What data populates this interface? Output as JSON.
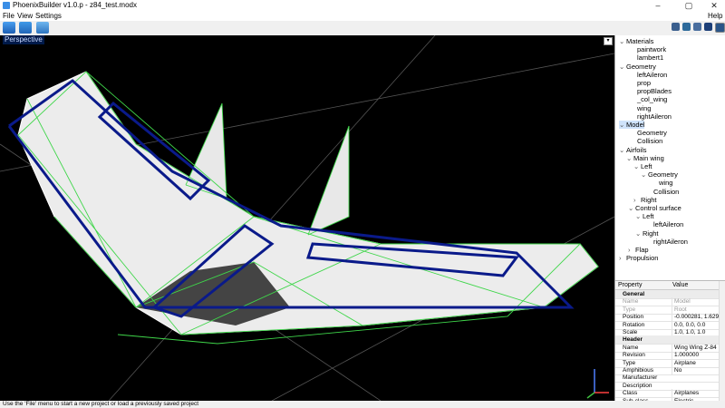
{
  "window": {
    "title": "PhoenixBuilder v1.0.p  - z84_test.modx",
    "controls": [
      "minimize-icon",
      "maximize-icon",
      "close-icon"
    ]
  },
  "menu": {
    "file": "File",
    "view": "View",
    "settings": "Settings",
    "help": "Help"
  },
  "viewport": {
    "label": "Perspective"
  },
  "tree": [
    {
      "label": "Materials",
      "toggle": "⌄"
    },
    {
      "label": "paintwork",
      "toggle": ""
    },
    {
      "label": "lambert1",
      "toggle": ""
    },
    {
      "label": "Geometry",
      "toggle": "⌄"
    },
    {
      "label": "leftAileron",
      "toggle": ""
    },
    {
      "label": "prop",
      "toggle": ""
    },
    {
      "label": "propBlades",
      "toggle": ""
    },
    {
      "label": "_col_wing",
      "toggle": ""
    },
    {
      "label": "wing",
      "toggle": ""
    },
    {
      "label": "rightAileron",
      "toggle": ""
    },
    {
      "label": "Model",
      "toggle": "⌄"
    },
    {
      "label": "Geometry",
      "toggle": ""
    },
    {
      "label": "Collision",
      "toggle": ""
    },
    {
      "label": "Airfoils",
      "toggle": "⌄"
    },
    {
      "label": "Main wing",
      "toggle": "⌄"
    },
    {
      "label": "Left",
      "toggle": "⌄"
    },
    {
      "label": "Geometry",
      "toggle": "⌄"
    },
    {
      "label": "wing",
      "toggle": ""
    },
    {
      "label": "Collision",
      "toggle": ""
    },
    {
      "label": "Right",
      "toggle": "›"
    },
    {
      "label": "Control surface",
      "toggle": "⌄"
    },
    {
      "label": "Left",
      "toggle": "⌄"
    },
    {
      "label": "leftAileron",
      "toggle": ""
    },
    {
      "label": "Right",
      "toggle": "⌄"
    },
    {
      "label": "rightAileron",
      "toggle": ""
    },
    {
      "label": "Flap",
      "toggle": "›"
    },
    {
      "label": "Propulsion",
      "toggle": "›"
    }
  ],
  "properties": {
    "col_property": "Property",
    "col_value": "Value",
    "rows": [
      {
        "k": "General",
        "v": "",
        "group": true
      },
      {
        "k": "Name",
        "v": "Model",
        "grey": true
      },
      {
        "k": "Type",
        "v": "Root",
        "grey": true
      },
      {
        "k": "Position",
        "v": "-0.000281, 1.6293...",
        "grey": false
      },
      {
        "k": "Rotation",
        "v": "0.0, 0.0, 0.0",
        "grey": false
      },
      {
        "k": "Scale",
        "v": "1.0, 1.0, 1.0",
        "grey": false
      },
      {
        "k": "Header",
        "v": "",
        "group": true
      },
      {
        "k": "Name",
        "v": "Wing Wing Z-84",
        "grey": false
      },
      {
        "k": "Revision",
        "v": "1.000000",
        "grey": false
      },
      {
        "k": "Type",
        "v": "Airplane",
        "grey": false
      },
      {
        "k": "Amphibious",
        "v": "No",
        "grey": false
      },
      {
        "k": "Manufacturer",
        "v": "",
        "grey": false
      },
      {
        "k": "Description",
        "v": "",
        "grey": false
      },
      {
        "k": "Class",
        "v": "Airplanes",
        "grey": false
      },
      {
        "k": "Sub-class",
        "v": "Electric",
        "grey": false
      }
    ]
  },
  "status": {
    "text": "Use the 'File' menu to start a new project or load a previously saved project"
  },
  "colors": {
    "accent": "#3a8ee6",
    "wireframe": "#3fd64a",
    "collision": "#0a1a8a",
    "selection": "#cfe3fb"
  }
}
